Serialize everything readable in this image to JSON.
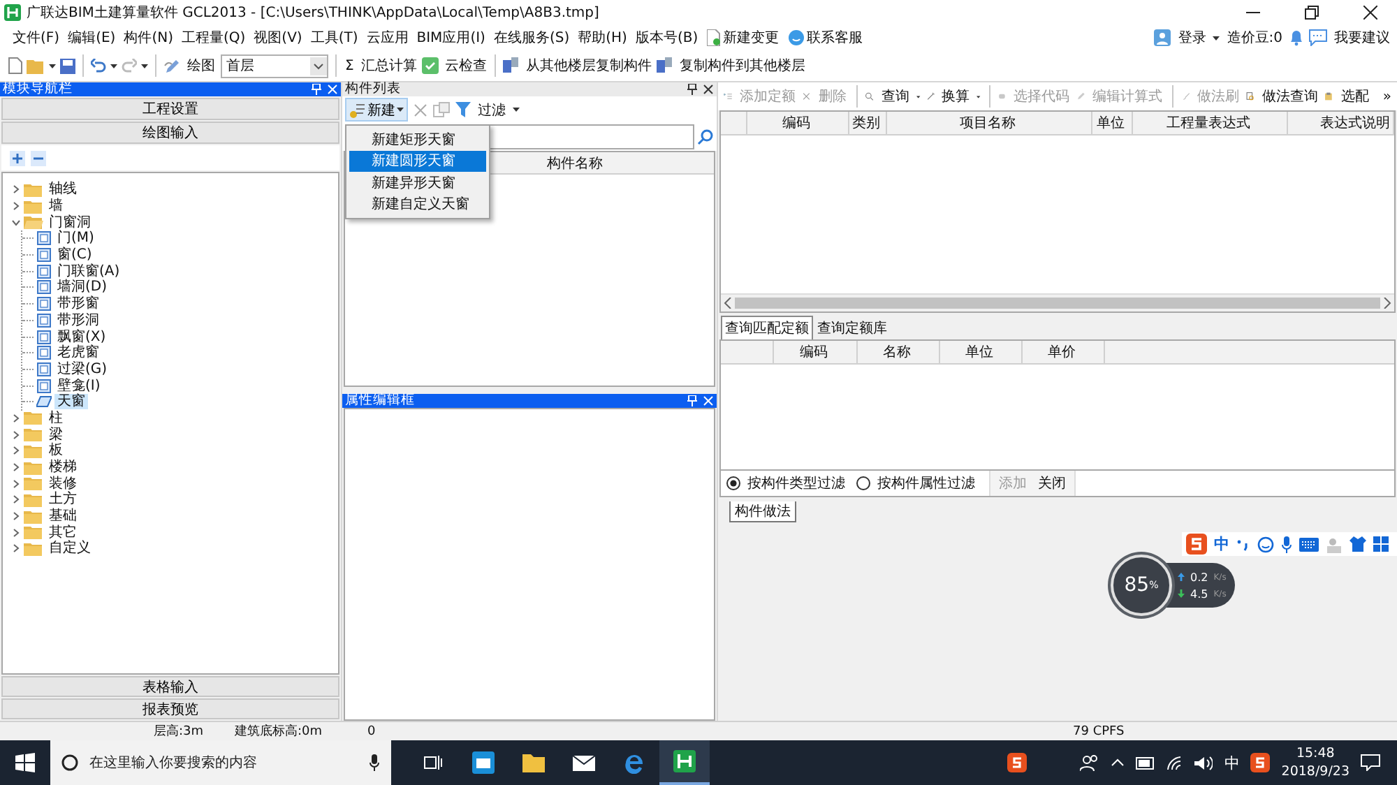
{
  "window": {
    "title": "广联达BIM土建算量软件 GCL2013 - [C:\\Users\\THINK\\AppData\\Local\\Temp\\A8B3.tmp]"
  },
  "menu": [
    "文件(F)",
    "编辑(E)",
    "构件(N)",
    "工程量(Q)",
    "视图(V)",
    "工具(T)",
    "云应用",
    "BIM应用(I)",
    "在线服务(S)",
    "帮助(H)",
    "版本号(B)"
  ],
  "menu_links": [
    "新建变更",
    "联系客服"
  ],
  "account": {
    "login": "登录",
    "beans": "造价豆:0",
    "suggest": "我要建议"
  },
  "toolbar": {
    "draw": "绘图",
    "floor": "首层",
    "sum_symbol": "Σ",
    "sum": "汇总计算",
    "check": "云检查",
    "copy_from": "从其他楼层复制构件",
    "copy_to": "复制构件到其他楼层"
  },
  "nav": {
    "title": "模块导航栏",
    "top_buttons": [
      "工程设置",
      "绘图输入"
    ],
    "tree": [
      {
        "label": "轴线",
        "expanded": false
      },
      {
        "label": "墙",
        "expanded": false
      },
      {
        "label": "门窗洞",
        "expanded": true,
        "children": [
          {
            "label": "门(M)",
            "selected": false
          },
          {
            "label": "窗(C)",
            "selected": false
          },
          {
            "label": "门联窗(A)",
            "selected": false
          },
          {
            "label": "墙洞(D)",
            "selected": false
          },
          {
            "label": "带形窗",
            "selected": false
          },
          {
            "label": "带形洞",
            "selected": false
          },
          {
            "label": "飘窗(X)",
            "selected": false
          },
          {
            "label": "老虎窗",
            "selected": false
          },
          {
            "label": "过梁(G)",
            "selected": false
          },
          {
            "label": "壁龛(I)",
            "selected": false
          },
          {
            "label": "天窗",
            "selected": true
          }
        ]
      },
      {
        "label": "柱",
        "expanded": false
      },
      {
        "label": "梁",
        "expanded": false
      },
      {
        "label": "板",
        "expanded": false
      },
      {
        "label": "楼梯",
        "expanded": false
      },
      {
        "label": "装修",
        "expanded": false
      },
      {
        "label": "土方",
        "expanded": false
      },
      {
        "label": "基础",
        "expanded": false
      },
      {
        "label": "其它",
        "expanded": false
      },
      {
        "label": "自定义",
        "expanded": false
      }
    ],
    "bottom_buttons": [
      "表格输入",
      "报表预览"
    ]
  },
  "component_list": {
    "title": "构件列表",
    "new": "新建",
    "filter": "过滤",
    "column": "构件名称",
    "menu": [
      {
        "label": "新建矩形天窗",
        "selected": false
      },
      {
        "label": "新建圆形天窗",
        "selected": true
      },
      {
        "label": "新建异形天窗",
        "selected": false
      },
      {
        "label": "新建自定义天窗",
        "selected": false
      }
    ]
  },
  "property_editor": {
    "title": "属性编辑框"
  },
  "methods": {
    "toolbar": [
      {
        "label": "添加定额",
        "disabled": true,
        "dropdown": false
      },
      {
        "label": "删除",
        "disabled": true,
        "dropdown": false
      },
      {
        "label": "查询",
        "disabled": false,
        "dropdown": true
      },
      {
        "label": "换算",
        "disabled": false,
        "dropdown": true
      },
      {
        "label": "选择代码",
        "disabled": true,
        "dropdown": false
      },
      {
        "label": "编辑计算式",
        "disabled": true,
        "dropdown": false
      },
      {
        "label": "做法刷",
        "disabled": true,
        "dropdown": false
      },
      {
        "label": "做法查询",
        "disabled": false,
        "dropdown": false
      },
      {
        "label": "选配",
        "disabled": false,
        "dropdown": false
      }
    ],
    "more": "»",
    "columns": [
      "编码",
      "类别",
      "项目名称",
      "单位",
      "工程量表达式",
      "表达式说明"
    ],
    "tabs": [
      {
        "label": "查询匹配定额",
        "selected": true
      },
      {
        "label": "查询定额库",
        "selected": false
      }
    ],
    "sub_columns": [
      "编码",
      "名称",
      "单位",
      "单价"
    ],
    "filters": [
      {
        "label": "按构件类型过滤",
        "selected": true
      },
      {
        "label": "按构件属性过滤",
        "selected": false
      }
    ],
    "actions": [
      {
        "label": "添加",
        "disabled": true
      },
      {
        "label": "关闭",
        "disabled": false
      }
    ],
    "bottom_tab": "构件做法"
  },
  "status_bar": [
    "层高:3m",
    "建筑底标高:0m",
    "0",
    "79 CPFS"
  ],
  "ime": {
    "mode": "中"
  },
  "net_widget": {
    "percent": "85",
    "percent_unit": "%",
    "up": "0.2",
    "up_unit": "K/s",
    "down": "4.5",
    "down_unit": "K/s"
  },
  "taskbar": {
    "search": "在这里输入你要搜索的内容",
    "ime": "中",
    "time": "15:48",
    "date": "2018/9/23"
  }
}
